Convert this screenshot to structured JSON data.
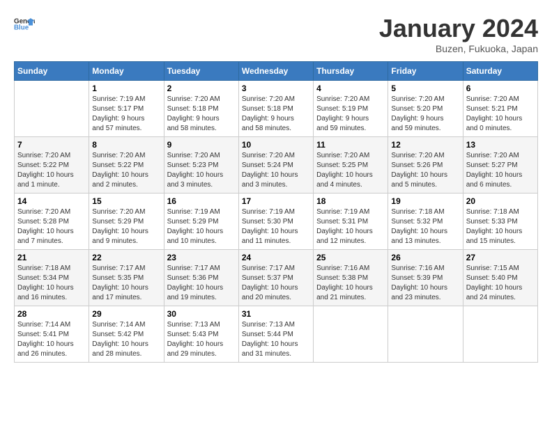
{
  "header": {
    "logo_general": "General",
    "logo_blue": "Blue",
    "month_title": "January 2024",
    "subtitle": "Buzen, Fukuoka, Japan"
  },
  "weekdays": [
    "Sunday",
    "Monday",
    "Tuesday",
    "Wednesday",
    "Thursday",
    "Friday",
    "Saturday"
  ],
  "weeks": [
    [
      {
        "day": "",
        "info": ""
      },
      {
        "day": "1",
        "info": "Sunrise: 7:19 AM\nSunset: 5:17 PM\nDaylight: 9 hours\nand 57 minutes."
      },
      {
        "day": "2",
        "info": "Sunrise: 7:20 AM\nSunset: 5:18 PM\nDaylight: 9 hours\nand 58 minutes."
      },
      {
        "day": "3",
        "info": "Sunrise: 7:20 AM\nSunset: 5:18 PM\nDaylight: 9 hours\nand 58 minutes."
      },
      {
        "day": "4",
        "info": "Sunrise: 7:20 AM\nSunset: 5:19 PM\nDaylight: 9 hours\nand 59 minutes."
      },
      {
        "day": "5",
        "info": "Sunrise: 7:20 AM\nSunset: 5:20 PM\nDaylight: 9 hours\nand 59 minutes."
      },
      {
        "day": "6",
        "info": "Sunrise: 7:20 AM\nSunset: 5:21 PM\nDaylight: 10 hours\nand 0 minutes."
      }
    ],
    [
      {
        "day": "7",
        "info": "Sunrise: 7:20 AM\nSunset: 5:22 PM\nDaylight: 10 hours\nand 1 minute."
      },
      {
        "day": "8",
        "info": "Sunrise: 7:20 AM\nSunset: 5:22 PM\nDaylight: 10 hours\nand 2 minutes."
      },
      {
        "day": "9",
        "info": "Sunrise: 7:20 AM\nSunset: 5:23 PM\nDaylight: 10 hours\nand 3 minutes."
      },
      {
        "day": "10",
        "info": "Sunrise: 7:20 AM\nSunset: 5:24 PM\nDaylight: 10 hours\nand 3 minutes."
      },
      {
        "day": "11",
        "info": "Sunrise: 7:20 AM\nSunset: 5:25 PM\nDaylight: 10 hours\nand 4 minutes."
      },
      {
        "day": "12",
        "info": "Sunrise: 7:20 AM\nSunset: 5:26 PM\nDaylight: 10 hours\nand 5 minutes."
      },
      {
        "day": "13",
        "info": "Sunrise: 7:20 AM\nSunset: 5:27 PM\nDaylight: 10 hours\nand 6 minutes."
      }
    ],
    [
      {
        "day": "14",
        "info": "Sunrise: 7:20 AM\nSunset: 5:28 PM\nDaylight: 10 hours\nand 7 minutes."
      },
      {
        "day": "15",
        "info": "Sunrise: 7:20 AM\nSunset: 5:29 PM\nDaylight: 10 hours\nand 9 minutes."
      },
      {
        "day": "16",
        "info": "Sunrise: 7:19 AM\nSunset: 5:29 PM\nDaylight: 10 hours\nand 10 minutes."
      },
      {
        "day": "17",
        "info": "Sunrise: 7:19 AM\nSunset: 5:30 PM\nDaylight: 10 hours\nand 11 minutes."
      },
      {
        "day": "18",
        "info": "Sunrise: 7:19 AM\nSunset: 5:31 PM\nDaylight: 10 hours\nand 12 minutes."
      },
      {
        "day": "19",
        "info": "Sunrise: 7:18 AM\nSunset: 5:32 PM\nDaylight: 10 hours\nand 13 minutes."
      },
      {
        "day": "20",
        "info": "Sunrise: 7:18 AM\nSunset: 5:33 PM\nDaylight: 10 hours\nand 15 minutes."
      }
    ],
    [
      {
        "day": "21",
        "info": "Sunrise: 7:18 AM\nSunset: 5:34 PM\nDaylight: 10 hours\nand 16 minutes."
      },
      {
        "day": "22",
        "info": "Sunrise: 7:17 AM\nSunset: 5:35 PM\nDaylight: 10 hours\nand 17 minutes."
      },
      {
        "day": "23",
        "info": "Sunrise: 7:17 AM\nSunset: 5:36 PM\nDaylight: 10 hours\nand 19 minutes."
      },
      {
        "day": "24",
        "info": "Sunrise: 7:17 AM\nSunset: 5:37 PM\nDaylight: 10 hours\nand 20 minutes."
      },
      {
        "day": "25",
        "info": "Sunrise: 7:16 AM\nSunset: 5:38 PM\nDaylight: 10 hours\nand 21 minutes."
      },
      {
        "day": "26",
        "info": "Sunrise: 7:16 AM\nSunset: 5:39 PM\nDaylight: 10 hours\nand 23 minutes."
      },
      {
        "day": "27",
        "info": "Sunrise: 7:15 AM\nSunset: 5:40 PM\nDaylight: 10 hours\nand 24 minutes."
      }
    ],
    [
      {
        "day": "28",
        "info": "Sunrise: 7:14 AM\nSunset: 5:41 PM\nDaylight: 10 hours\nand 26 minutes."
      },
      {
        "day": "29",
        "info": "Sunrise: 7:14 AM\nSunset: 5:42 PM\nDaylight: 10 hours\nand 28 minutes."
      },
      {
        "day": "30",
        "info": "Sunrise: 7:13 AM\nSunset: 5:43 PM\nDaylight: 10 hours\nand 29 minutes."
      },
      {
        "day": "31",
        "info": "Sunrise: 7:13 AM\nSunset: 5:44 PM\nDaylight: 10 hours\nand 31 minutes."
      },
      {
        "day": "",
        "info": ""
      },
      {
        "day": "",
        "info": ""
      },
      {
        "day": "",
        "info": ""
      }
    ]
  ]
}
